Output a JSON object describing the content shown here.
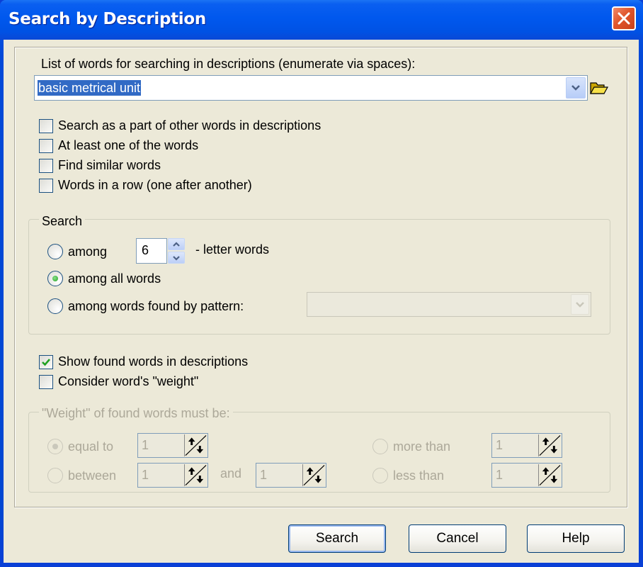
{
  "window": {
    "title": "Search by Description",
    "close_icon": "close-x-icon"
  },
  "words": {
    "label": "List of words for searching in descriptions (enumerate via spaces):",
    "value": "basic metrical unit",
    "dropdown_icon": "chevron-down-icon",
    "browse_icon": "open-folder-icon"
  },
  "options": [
    {
      "label": "Search as a part of other words in descriptions",
      "checked": false
    },
    {
      "label": "At least one of the words",
      "checked": false
    },
    {
      "label": "Find similar words",
      "checked": false
    },
    {
      "label": "Words in a row (one after another)",
      "checked": false
    }
  ],
  "search_group": {
    "legend": "Search",
    "among_label": "among",
    "letter_count": "6",
    "letter_suffix": "- letter words",
    "all_words_label": "among all words",
    "pattern_label": "among words found by pattern:",
    "pattern_value": "",
    "selected": "among all words"
  },
  "display": [
    {
      "label": "Show found words in descriptions",
      "checked": true
    },
    {
      "label": "Consider word's \"weight\"",
      "checked": false
    }
  ],
  "weight_group": {
    "legend": "\"Weight\" of found words must be:",
    "equal_label": "equal to",
    "equal_value": "1",
    "between_label": "between",
    "between_from": "1",
    "and_label": "and",
    "between_to": "1",
    "more_label": "more than",
    "more_value": "1",
    "less_label": "less than",
    "less_value": "1",
    "selected": "equal to",
    "enabled": false
  },
  "buttons": {
    "search": "Search",
    "cancel": "Cancel",
    "help": "Help"
  }
}
